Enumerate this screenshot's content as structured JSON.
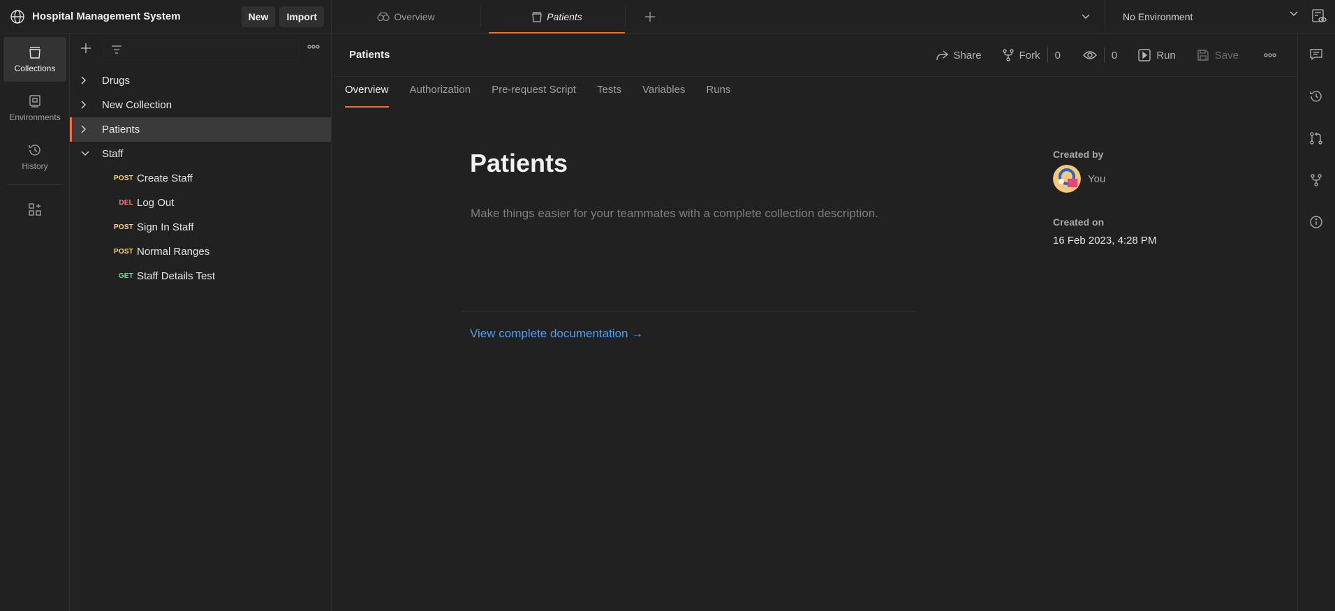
{
  "workspace": {
    "name": "Hospital Management System",
    "new_label": "New",
    "import_label": "Import",
    "icon": "globe-icon"
  },
  "tabs": [
    {
      "label": "Overview",
      "icon": "overview-icon",
      "active": false
    },
    {
      "label": "Patients",
      "icon": "collection-icon",
      "active": true
    }
  ],
  "environment": {
    "selected": "No Environment"
  },
  "rail": [
    {
      "label": "Collections",
      "icon": "collections-icon",
      "active": true
    },
    {
      "label": "Environments",
      "icon": "environments-icon",
      "active": false
    },
    {
      "label": "History",
      "icon": "history-icon",
      "active": false
    }
  ],
  "collections": [
    {
      "name": "Drugs",
      "expanded": false
    },
    {
      "name": "New Collection",
      "expanded": false
    },
    {
      "name": "Patients",
      "expanded": false,
      "selected": true
    },
    {
      "name": "Staff",
      "expanded": true
    }
  ],
  "requests": [
    {
      "method": "POST",
      "name": "Create Staff"
    },
    {
      "method": "DEL",
      "name": "Log Out"
    },
    {
      "method": "POST",
      "name": "Sign In Staff"
    },
    {
      "method": "POST",
      "name": "Normal Ranges"
    },
    {
      "method": "GET",
      "name": "Staff Details Test"
    }
  ],
  "header": {
    "title": "Patients",
    "share_label": "Share",
    "fork_label": "Fork",
    "fork_count": "0",
    "watch_count": "0",
    "run_label": "Run",
    "save_label": "Save"
  },
  "subtabs": [
    "Overview",
    "Authorization",
    "Pre-request Script",
    "Tests",
    "Variables",
    "Runs"
  ],
  "overview": {
    "title": "Patients",
    "description_placeholder": "Make things easier for your teammates with a complete collection description.",
    "docs_link": "View complete documentation →",
    "created_by_label": "Created by",
    "created_by": "You",
    "created_on_label": "Created on",
    "created_on": "16 Feb 2023, 4:28 PM"
  },
  "colors": {
    "accent": "#f26b3a",
    "link": "#4f9cf0",
    "post": "#ffd57a",
    "delete": "#f07d7d",
    "get": "#6bdd9a"
  }
}
